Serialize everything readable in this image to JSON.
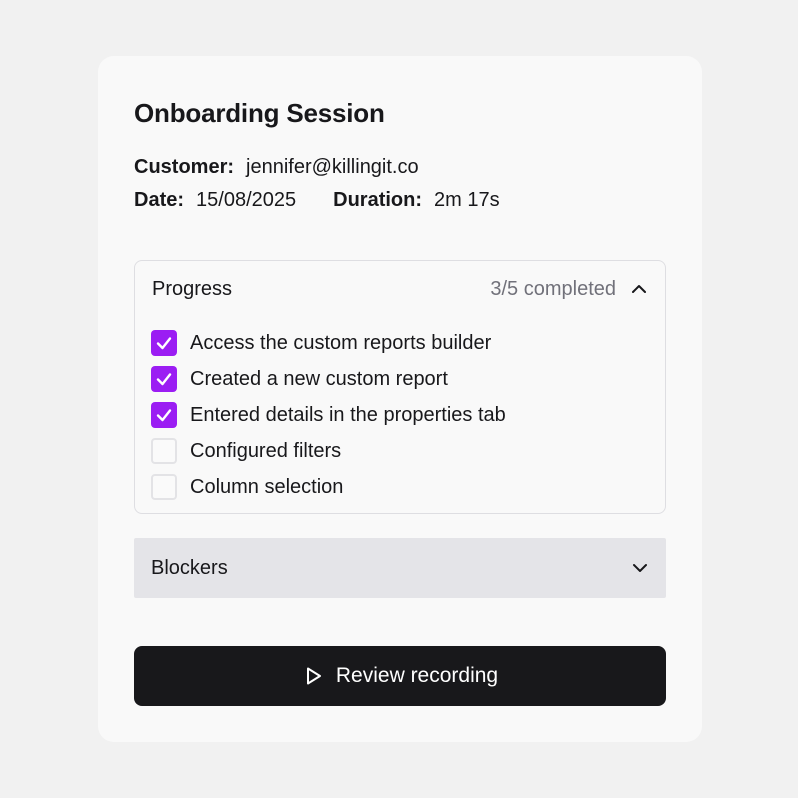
{
  "session": {
    "title": "Onboarding Session",
    "customer_label": "Customer:",
    "customer_value": "jennifer@killingit.co",
    "date_label": "Date:",
    "date_value": "15/08/2025",
    "duration_label": "Duration:",
    "duration_value": "2m 17s"
  },
  "progress": {
    "title": "Progress",
    "count_text": "3/5 completed",
    "expanded": true,
    "toggle_icon": "chevron-up-icon",
    "tasks": [
      {
        "label": "Access the custom reports builder",
        "checked": true
      },
      {
        "label": "Created a new custom report",
        "checked": true
      },
      {
        "label": "Entered details in the properties tab",
        "checked": true
      },
      {
        "label": "Configured filters",
        "checked": false
      },
      {
        "label": "Column selection",
        "checked": false
      }
    ]
  },
  "blockers": {
    "title": "Blockers",
    "expanded": false,
    "toggle_icon": "chevron-down-icon"
  },
  "actions": {
    "review_label": "Review recording",
    "review_icon": "play-icon"
  },
  "colors": {
    "accent": "#9b1df3",
    "button_bg": "#18181b",
    "muted_text": "#71717a",
    "collapsed_panel_bg": "#e4e4e8"
  }
}
